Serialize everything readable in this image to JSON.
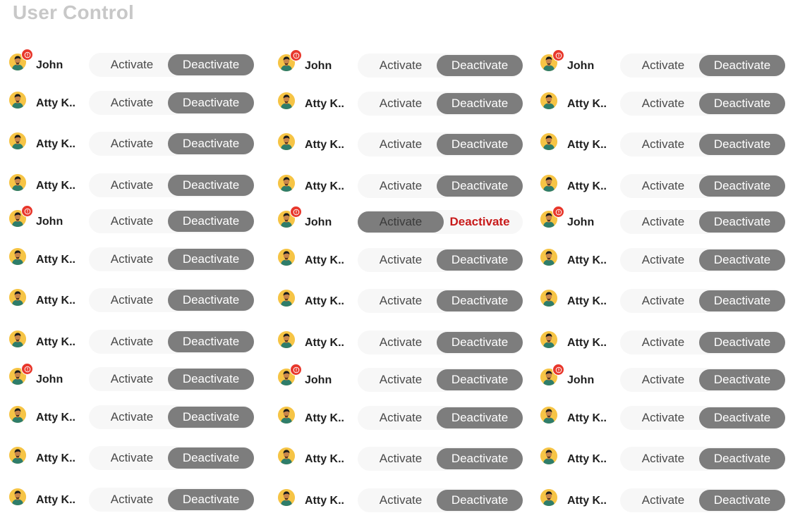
{
  "page": {
    "title": "User Control"
  },
  "labels": {
    "activate": "Activate",
    "deactivate": "Deactivate"
  },
  "icons": {
    "avatar": "user-avatar-icon",
    "badge": "alert-icon"
  },
  "colors": {
    "title": "#c8c8c8",
    "avatar_bg": "#f6c445",
    "badge": "#e8372b",
    "toggle_track": "#f7f7f7",
    "toggle_selected": "#7d7d7d",
    "deactivate_alert_text": "#c81b1b"
  },
  "users": [
    [
      {
        "name": "John",
        "alert": true,
        "state": "deactivated"
      },
      {
        "name": "John",
        "alert": true,
        "state": "deactivated"
      },
      {
        "name": "John",
        "alert": true,
        "state": "deactivated"
      }
    ],
    [
      {
        "name": "Atty K..",
        "alert": false,
        "state": "deactivated"
      },
      {
        "name": "Atty K..",
        "alert": false,
        "state": "deactivated"
      },
      {
        "name": "Atty K..",
        "alert": false,
        "state": "deactivated"
      }
    ],
    [
      {
        "name": "Atty K..",
        "alert": false,
        "state": "deactivated"
      },
      {
        "name": "Atty K..",
        "alert": false,
        "state": "deactivated"
      },
      {
        "name": "Atty K..",
        "alert": false,
        "state": "deactivated"
      }
    ],
    [
      {
        "name": "Atty K..",
        "alert": false,
        "state": "deactivated"
      },
      {
        "name": "Atty K..",
        "alert": false,
        "state": "deactivated"
      },
      {
        "name": "Atty K..",
        "alert": false,
        "state": "deactivated"
      }
    ],
    [
      {
        "name": "John",
        "alert": true,
        "state": "deactivated"
      },
      {
        "name": "John",
        "alert": true,
        "state": "activated"
      },
      {
        "name": "John",
        "alert": true,
        "state": "deactivated"
      }
    ],
    [
      {
        "name": "Atty K..",
        "alert": false,
        "state": "deactivated"
      },
      {
        "name": "Atty K..",
        "alert": false,
        "state": "deactivated"
      },
      {
        "name": "Atty K..",
        "alert": false,
        "state": "deactivated"
      }
    ],
    [
      {
        "name": "Atty K..",
        "alert": false,
        "state": "deactivated"
      },
      {
        "name": "Atty K..",
        "alert": false,
        "state": "deactivated"
      },
      {
        "name": "Atty K..",
        "alert": false,
        "state": "deactivated"
      }
    ],
    [
      {
        "name": "Atty K..",
        "alert": false,
        "state": "deactivated"
      },
      {
        "name": "Atty K..",
        "alert": false,
        "state": "deactivated"
      },
      {
        "name": "Atty K..",
        "alert": false,
        "state": "deactivated"
      }
    ],
    [
      {
        "name": "John",
        "alert": true,
        "state": "deactivated"
      },
      {
        "name": "John",
        "alert": true,
        "state": "deactivated"
      },
      {
        "name": "John",
        "alert": true,
        "state": "deactivated"
      }
    ],
    [
      {
        "name": "Atty K..",
        "alert": false,
        "state": "deactivated"
      },
      {
        "name": "Atty K..",
        "alert": false,
        "state": "deactivated"
      },
      {
        "name": "Atty K..",
        "alert": false,
        "state": "deactivated"
      }
    ],
    [
      {
        "name": "Atty K..",
        "alert": false,
        "state": "deactivated"
      },
      {
        "name": "Atty K..",
        "alert": false,
        "state": "deactivated"
      },
      {
        "name": "Atty K..",
        "alert": false,
        "state": "deactivated"
      }
    ],
    [
      {
        "name": "Atty K..",
        "alert": false,
        "state": "deactivated"
      },
      {
        "name": "Atty K..",
        "alert": false,
        "state": "deactivated"
      },
      {
        "name": "Atty K..",
        "alert": false,
        "state": "deactivated"
      }
    ]
  ]
}
